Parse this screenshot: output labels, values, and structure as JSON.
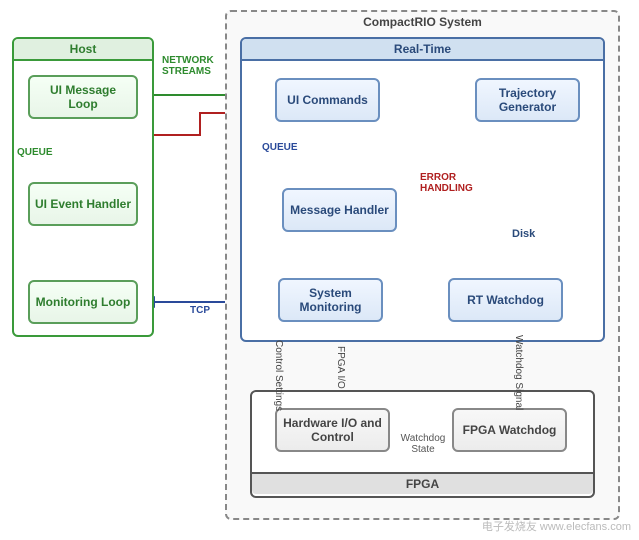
{
  "host": {
    "title": "Host",
    "ui_message_loop": "UI Message Loop",
    "ui_event_handler": "UI Event Handler",
    "monitoring_loop": "Monitoring Loop"
  },
  "crio": {
    "title": "CompactRIO System",
    "realtime": {
      "title": "Real-Time",
      "ui_commands": "UI Commands",
      "trajectory_generator": "Trajectory Generator",
      "message_handler": "Message Handler",
      "system_monitoring": "System Monitoring",
      "rt_watchdog": "RT Watchdog",
      "disk": "Disk"
    },
    "fpga": {
      "title": "FPGA",
      "hardware_io": "Hardware I/O and Control",
      "fpga_watchdog": "FPGA Watchdog"
    }
  },
  "labels": {
    "network_streams": "NETWORK STREAMS",
    "queue1": "QUEUE",
    "queue2": "QUEUE",
    "tcp": "TCP",
    "error_handling": "ERROR HANDLING",
    "control_settings": "Control Settings",
    "fpga_io": "FPGA I/O",
    "watchdog_signal": "Watchdog Signal",
    "watchdog_state": "Watchdog State"
  },
  "watermark": "电子发烧友 www.elecfans.com"
}
